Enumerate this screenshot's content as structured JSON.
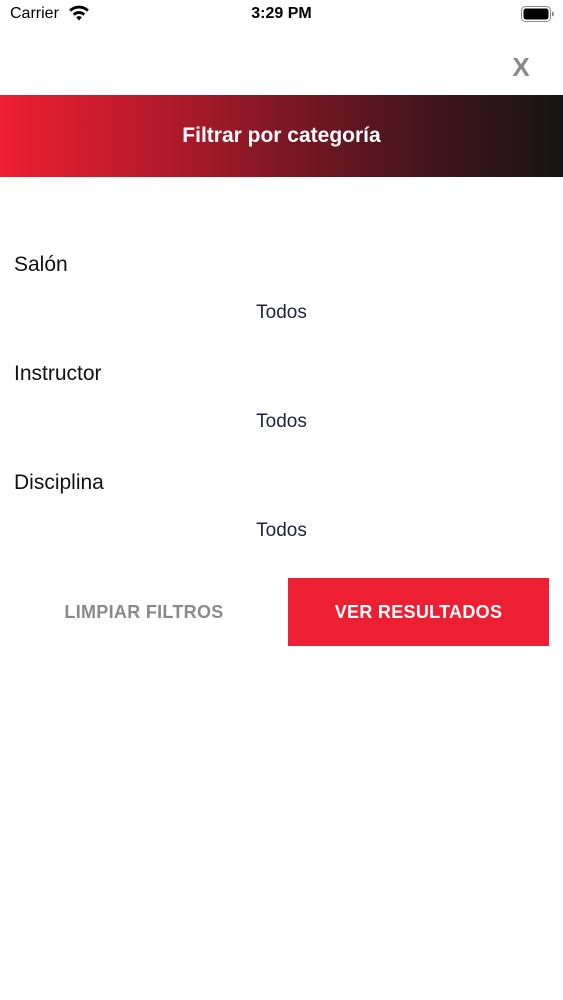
{
  "status_bar": {
    "carrier": "Carrier",
    "time": "3:29 PM",
    "wifi_icon": "wifi-icon",
    "battery_icon": "battery-icon"
  },
  "close": {
    "label": "X"
  },
  "header": {
    "title": "Filtrar por categoría",
    "gradient_colors": [
      "#ee1f32",
      "#141414"
    ]
  },
  "filters": [
    {
      "label": "Salón",
      "value": "Todos"
    },
    {
      "label": "Instructor",
      "value": "Todos"
    },
    {
      "label": "Disciplina",
      "value": "Todos"
    }
  ],
  "actions": {
    "clear_label": "LIMPIAR FILTROS",
    "results_label": "VER RESULTADOS",
    "accent_color": "#ec1f33"
  }
}
